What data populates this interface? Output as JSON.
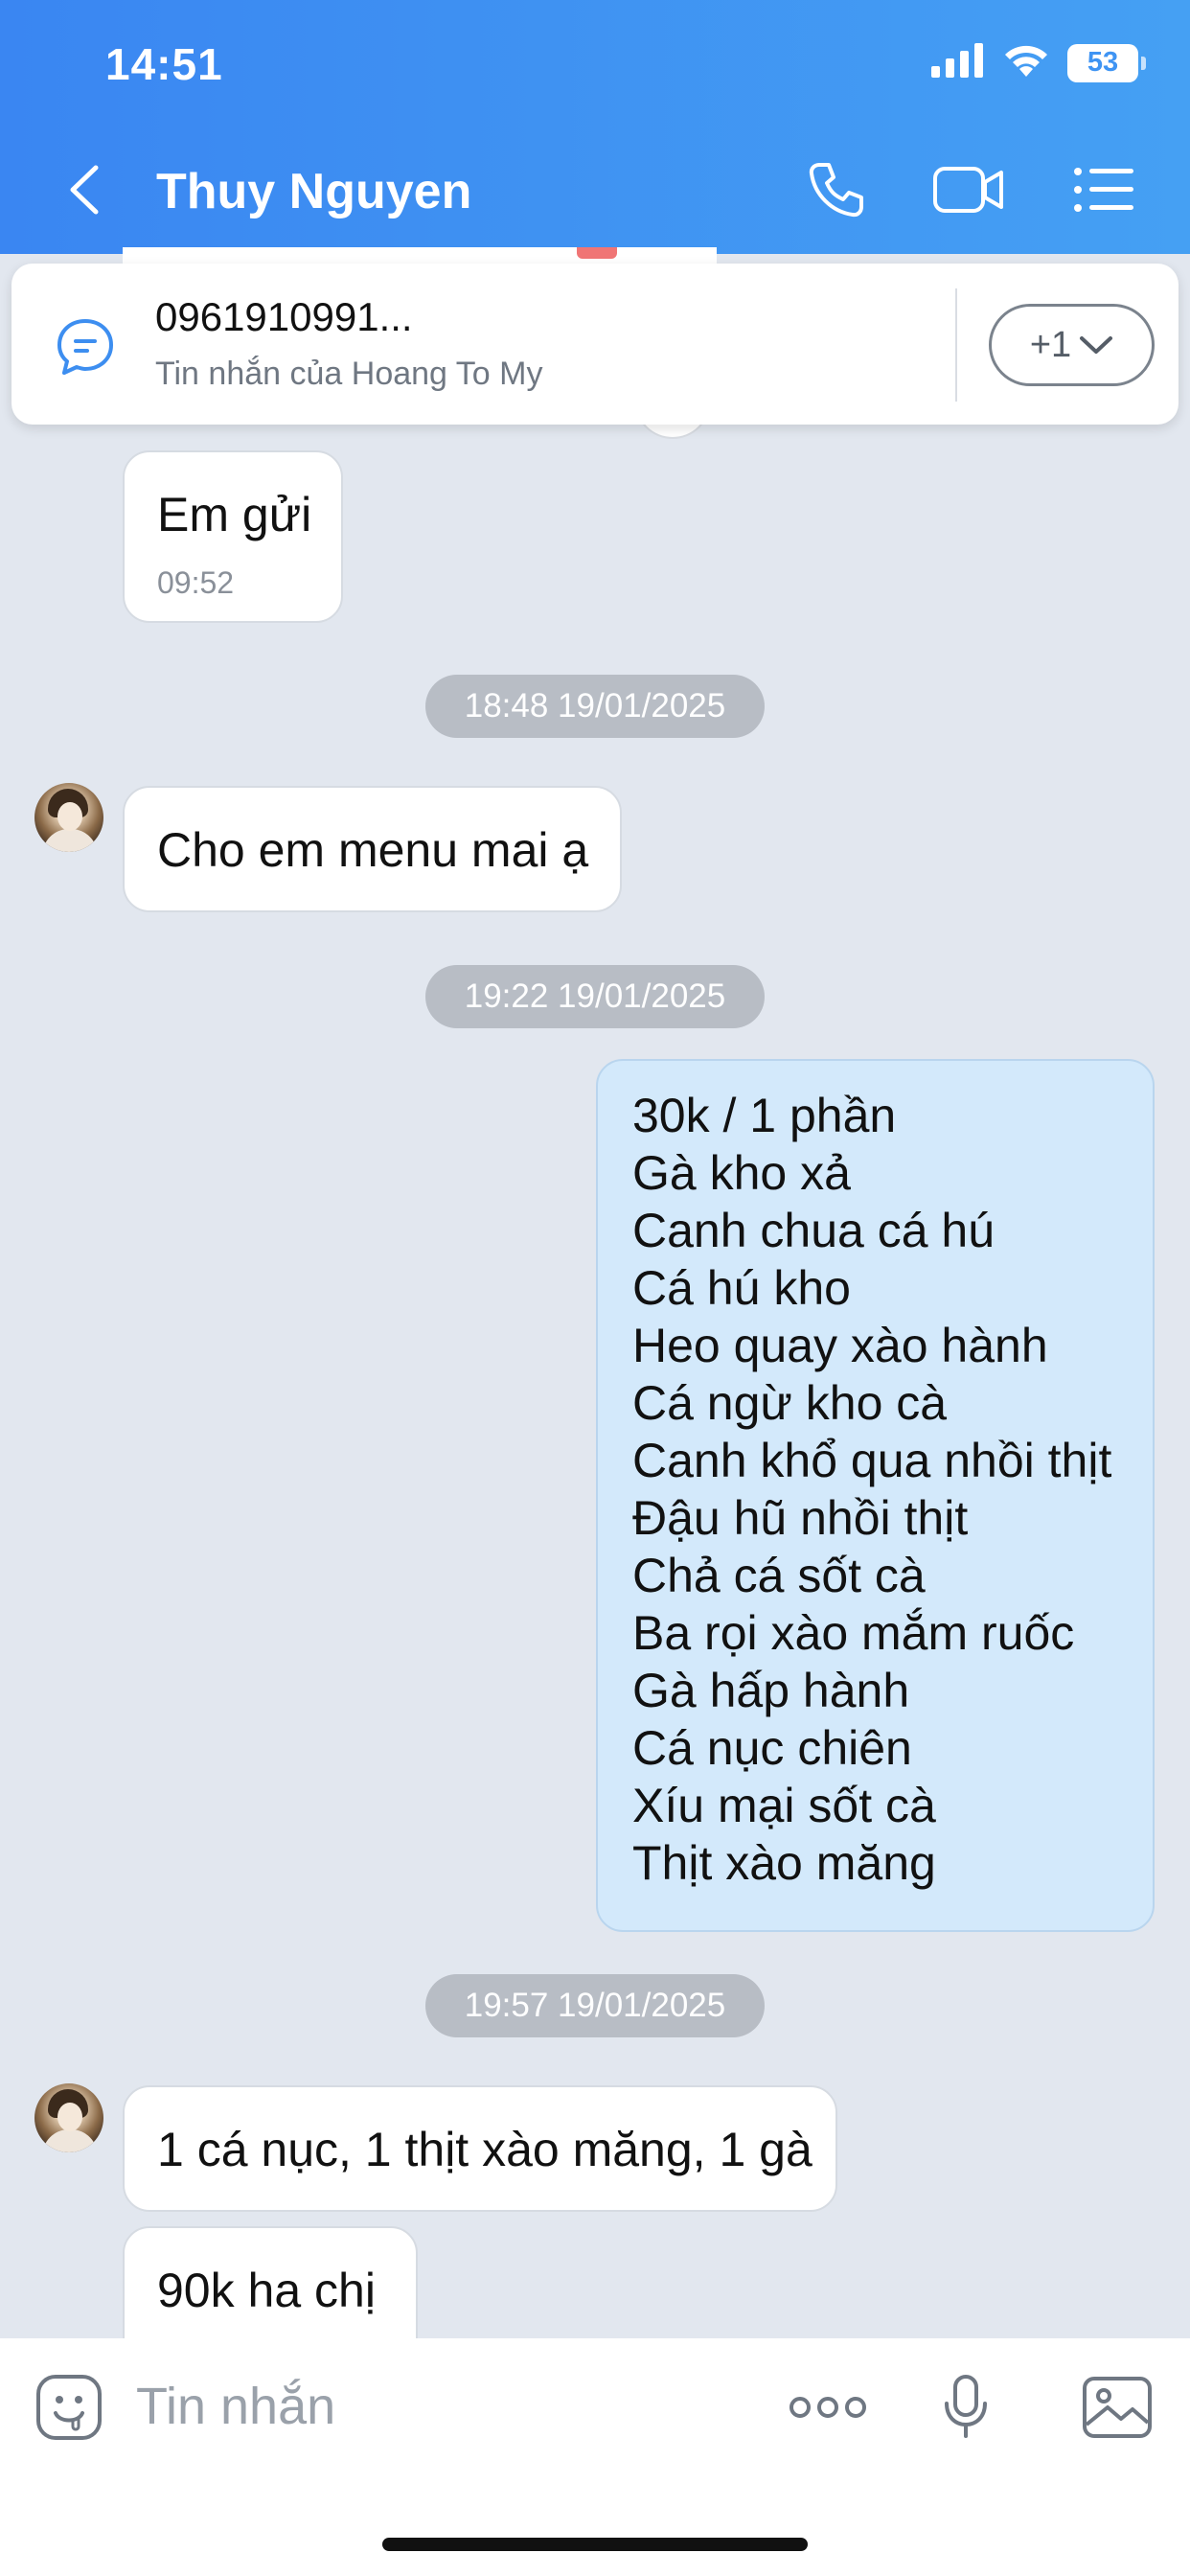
{
  "status_bar": {
    "time": "14:51",
    "battery": "53",
    "icons": [
      "signal-icon",
      "wifi-icon",
      "battery-icon"
    ]
  },
  "header": {
    "contact_name": "Thuy Nguyen",
    "icons": [
      "back-chevron-icon",
      "phone-icon",
      "video-call-icon",
      "list-menu-icon"
    ],
    "color_start": "#3a86f2",
    "color_end": "#45a0f3"
  },
  "pinned": {
    "title": "0961910991...",
    "subtitle": "Tin nhắn của Hoang To My",
    "more_label": "+1",
    "icon": "message-bubble-icon"
  },
  "messages": {
    "m1": {
      "text": "Em gửi",
      "time": "09:52"
    },
    "ts1": "18:48 19/01/2025",
    "m2": {
      "text": "Cho em menu mai ạ"
    },
    "ts2": "19:22 19/01/2025",
    "menu": [
      "30k / 1 phần",
      "Gà kho xả",
      "Canh chua cá hú",
      "Cá hú kho",
      "Heo quay xào hành",
      "Cá ngừ kho cà",
      "Canh khổ qua nhồi thịt",
      "Đậu hũ nhồi thịt",
      "Chả cá sốt cà",
      "Ba rọi xào mắm ruốc",
      "Gà hấp hành",
      "Cá nục chiên",
      "Xíu mại sốt cà",
      "Thịt xào măng"
    ],
    "ts3": "19:57 19/01/2025",
    "m3": {
      "text": "1 cá nục, 1 thịt xào măng, 1 gà"
    },
    "m4": {
      "text": "90k ha chị"
    }
  },
  "input": {
    "placeholder": "Tin nhắn",
    "icons": [
      "sticker-icon",
      "more-options-icon",
      "microphone-icon",
      "image-icon"
    ]
  },
  "colors": {
    "chat_background": "#e2e7ef",
    "sent_bubble": "#d3e9fb",
    "received_bubble": "#ffffff",
    "timestamp_pill": "#b8bdc5"
  }
}
